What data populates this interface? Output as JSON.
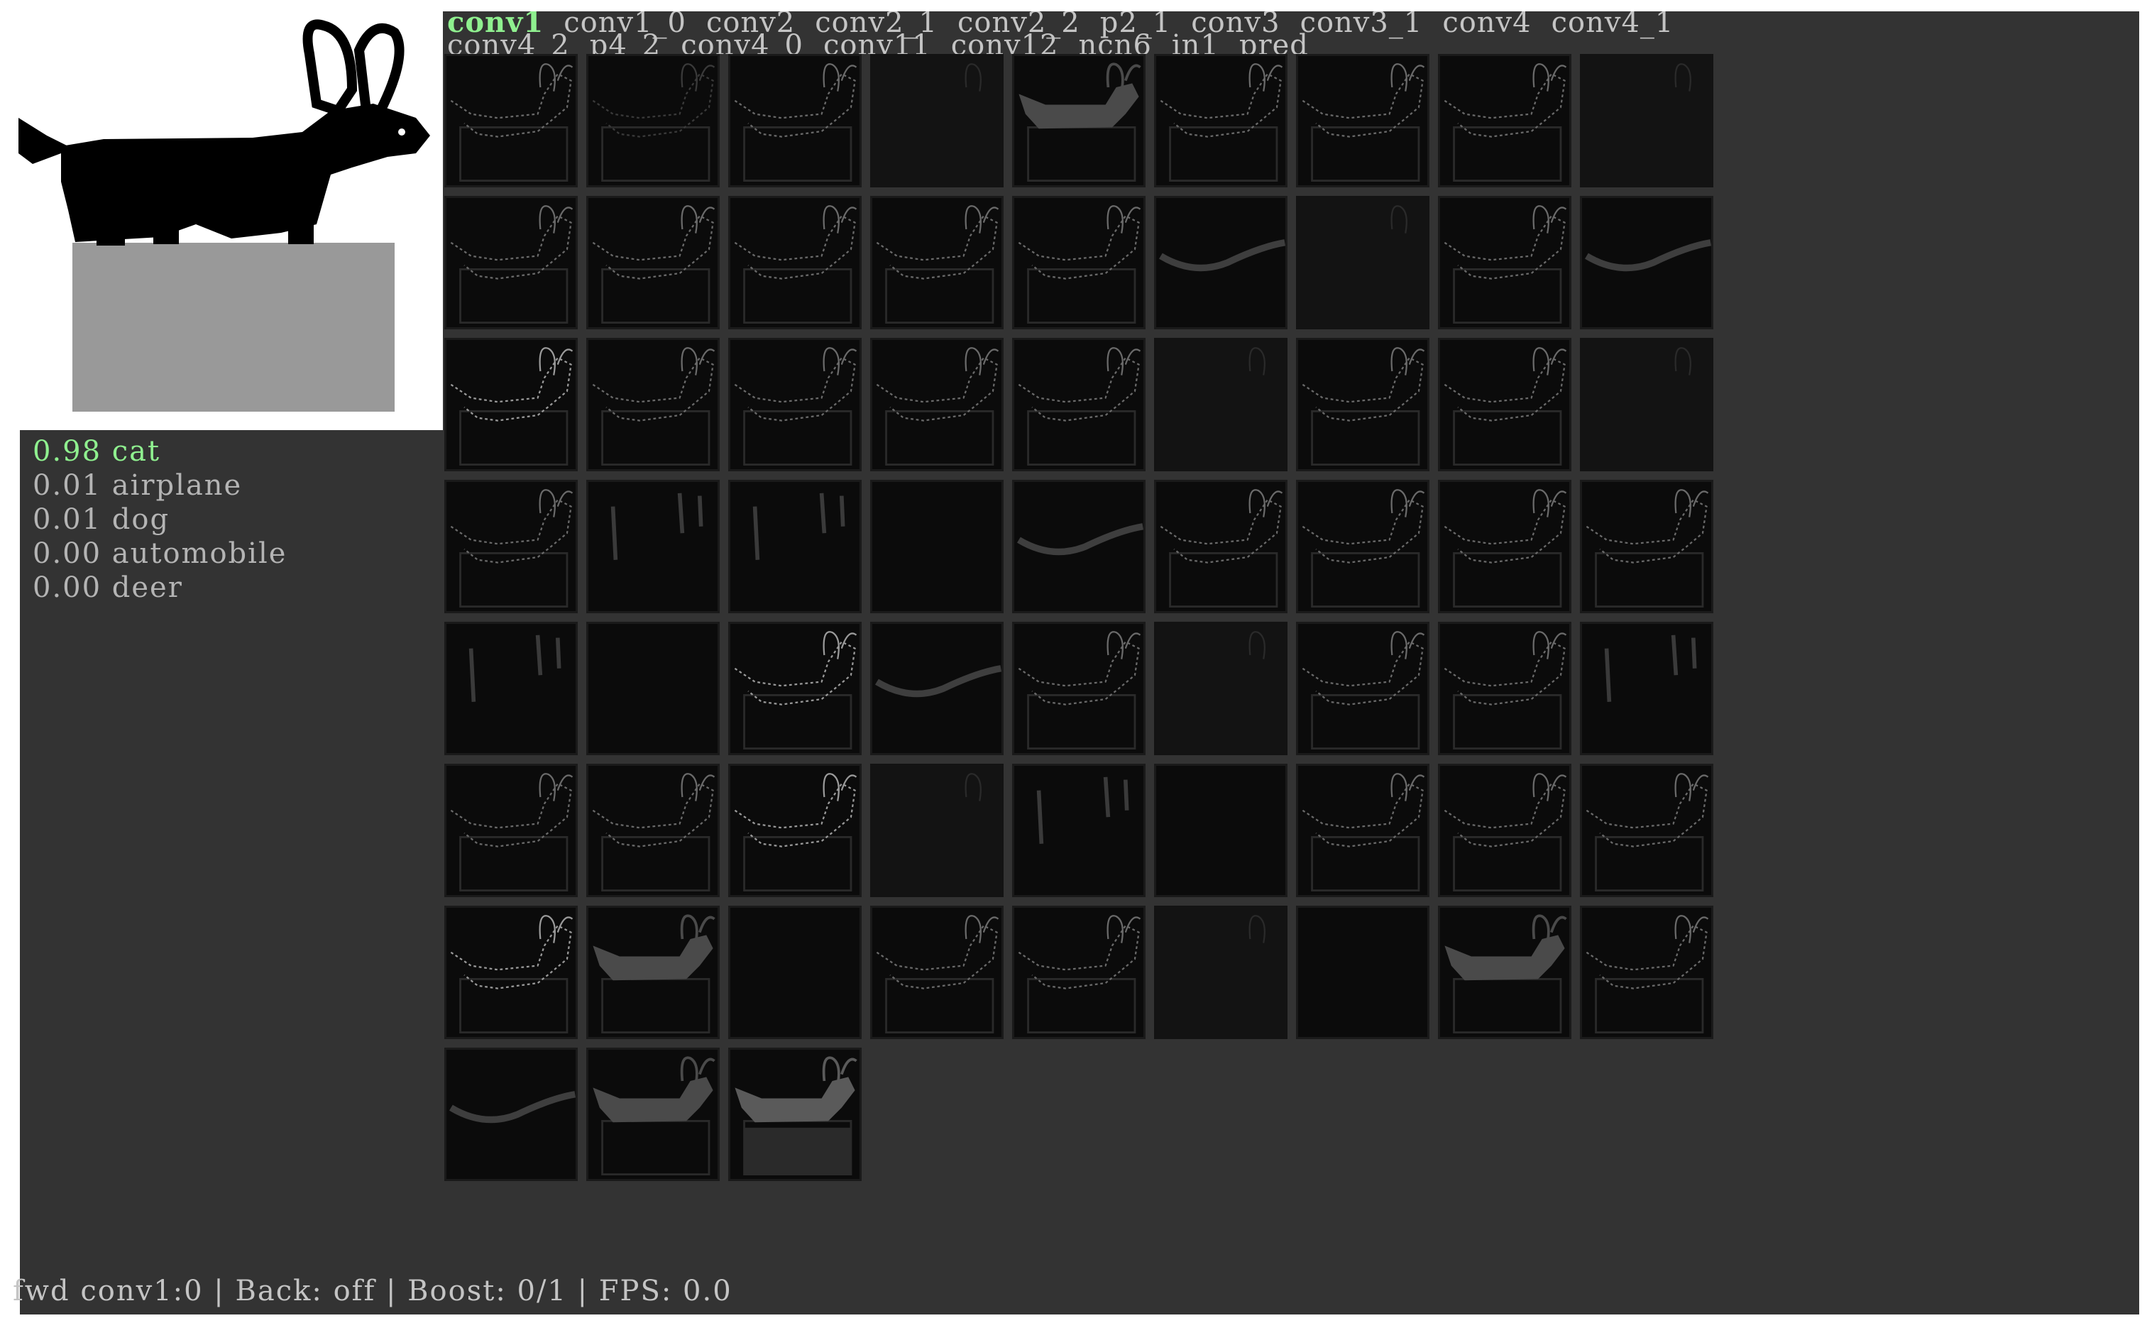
{
  "predictions": [
    {
      "score": "0.98",
      "label": "cat"
    },
    {
      "score": "0.01",
      "label": "airplane"
    },
    {
      "score": "0.01",
      "label": "dog"
    },
    {
      "score": "0.00",
      "label": "automobile"
    },
    {
      "score": "0.00",
      "label": "deer"
    }
  ],
  "layers": [
    "conv1",
    "conv1_0",
    "conv2",
    "conv2_1",
    "conv2_2",
    "p2_1",
    "conv3",
    "conv3_1",
    "conv4",
    "conv4_1",
    "conv4_2",
    "p4_2",
    "conv4_0",
    "conv11",
    "conv12",
    "ncn6",
    "in1",
    "pred"
  ],
  "active_layer": "conv1",
  "status": "fwd conv1:0 | Back: off | Boost: 0/1 | FPS: 0.0",
  "tiles": {
    "count": 66,
    "variants": [
      "outline",
      "dim",
      "outline",
      "faint",
      "filled",
      "outline",
      "outline",
      "outline",
      "faint",
      "outline",
      "outline",
      "outline",
      "outline",
      "outline",
      "stroke",
      "faint",
      "outline",
      "stroke",
      "bright",
      "outline",
      "outline",
      "outline",
      "outline",
      "faint",
      "outline",
      "outline",
      "faint",
      "outline",
      "vert",
      "vert",
      "blank",
      "stroke",
      "outline",
      "outline",
      "outline",
      "outline",
      "vert",
      "blank",
      "bright",
      "stroke",
      "outline",
      "faint",
      "outline",
      "outline",
      "vert",
      "outline",
      "outline",
      "bright",
      "faint",
      "vert",
      "blank",
      "outline",
      "outline",
      "outline",
      "bright",
      "filled",
      "blank",
      "outline",
      "outline",
      "faint",
      "blank",
      "filled",
      "outline",
      "stroke",
      "filled",
      "filled-light"
    ]
  },
  "colors": {
    "panel_bg": "#333333",
    "active_tab": "#8ff08f",
    "text": "#c4c4c4",
    "tile_bg": "#0b0b0b"
  }
}
